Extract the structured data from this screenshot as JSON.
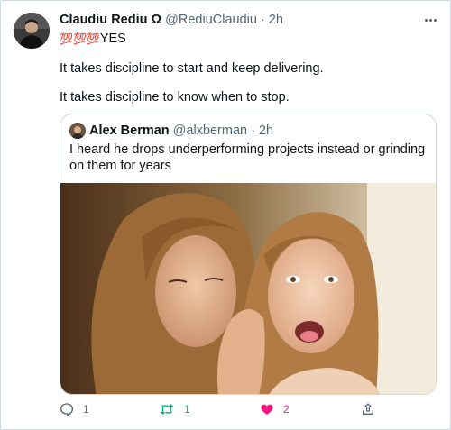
{
  "tweet": {
    "author_name": "Claudiu Rediu Ω",
    "author_handle": "@RediuClaudiu",
    "separator": "·",
    "time": "2h",
    "emoji_text": "💯💯💯",
    "line1_text": "YES",
    "paragraph1": "It takes discipline to start and keep delivering.",
    "paragraph2": "It takes discipline to know when to stop."
  },
  "quoted": {
    "author_name": "Alex Berman",
    "author_handle": "@alxberman",
    "separator": "·",
    "time": "2h",
    "text": "I heard he drops underperforming projects instead or grinding on them for years"
  },
  "actions": {
    "reply_count": "1",
    "retweet_count": "1",
    "like_count": "2"
  },
  "colors": {
    "retweet": "#00ba7c",
    "like": "#f91880",
    "muted": "#536471",
    "border": "#cfd9de"
  },
  "icons": [
    "more-icon",
    "reply-icon",
    "retweet-icon",
    "like-icon",
    "share-icon"
  ]
}
